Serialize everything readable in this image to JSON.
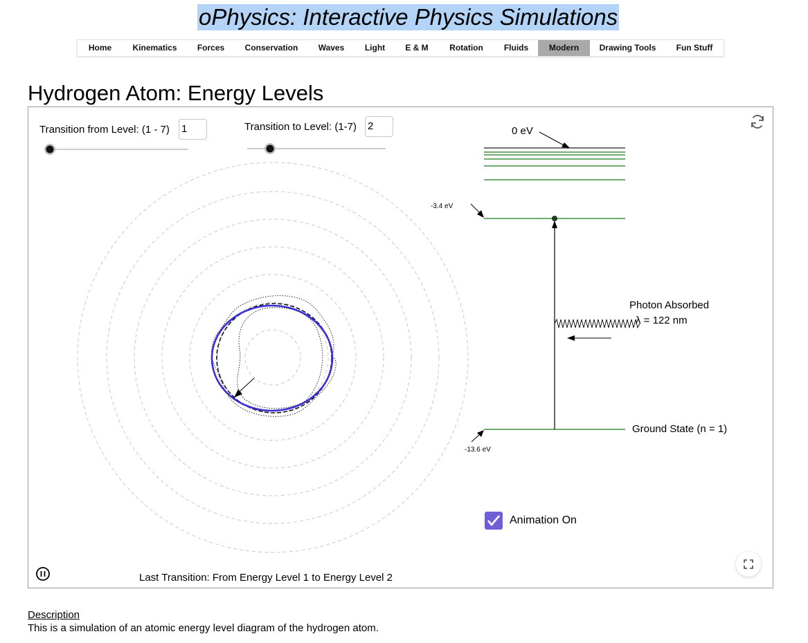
{
  "site": {
    "title": "oPhysics: Interactive Physics Simulations"
  },
  "nav": {
    "items": [
      {
        "label": "Home",
        "active": false
      },
      {
        "label": "Kinematics",
        "active": false
      },
      {
        "label": "Forces",
        "active": false
      },
      {
        "label": "Conservation",
        "active": false
      },
      {
        "label": "Waves",
        "active": false
      },
      {
        "label": "Light",
        "active": false
      },
      {
        "label": "E & M",
        "active": false
      },
      {
        "label": "Rotation",
        "active": false
      },
      {
        "label": "Fluids",
        "active": false
      },
      {
        "label": "Modern",
        "active": true
      },
      {
        "label": "Drawing Tools",
        "active": false
      },
      {
        "label": "Fun Stuff",
        "active": false
      }
    ]
  },
  "page": {
    "title": "Hydrogen Atom: Energy Levels"
  },
  "controls": {
    "from_label": "Transition from Level: (1 - 7)",
    "from_value": "1",
    "to_label": "Transition to Level: (1-7)",
    "to_value": "2",
    "animation_label": "Animation On",
    "animation_checked": true
  },
  "diagram": {
    "zero_label": "0 eV",
    "level2_label": "-3.4 eV",
    "ground_energy_label": "-13.6 eV",
    "ground_state_label": "Ground State (n = 1)",
    "photon_label": "Photon Absorbed",
    "wavelength_label": "λ = 122 nm",
    "level_color": "#1a7a1a",
    "orbit_color": "#3a2fd6"
  },
  "status": {
    "last_transition": "Last Transition: From Energy Level 1 to Energy Level 2"
  },
  "description": {
    "heading": "Description",
    "text": "This is a simulation of an atomic energy level diagram of the hydrogen atom."
  }
}
